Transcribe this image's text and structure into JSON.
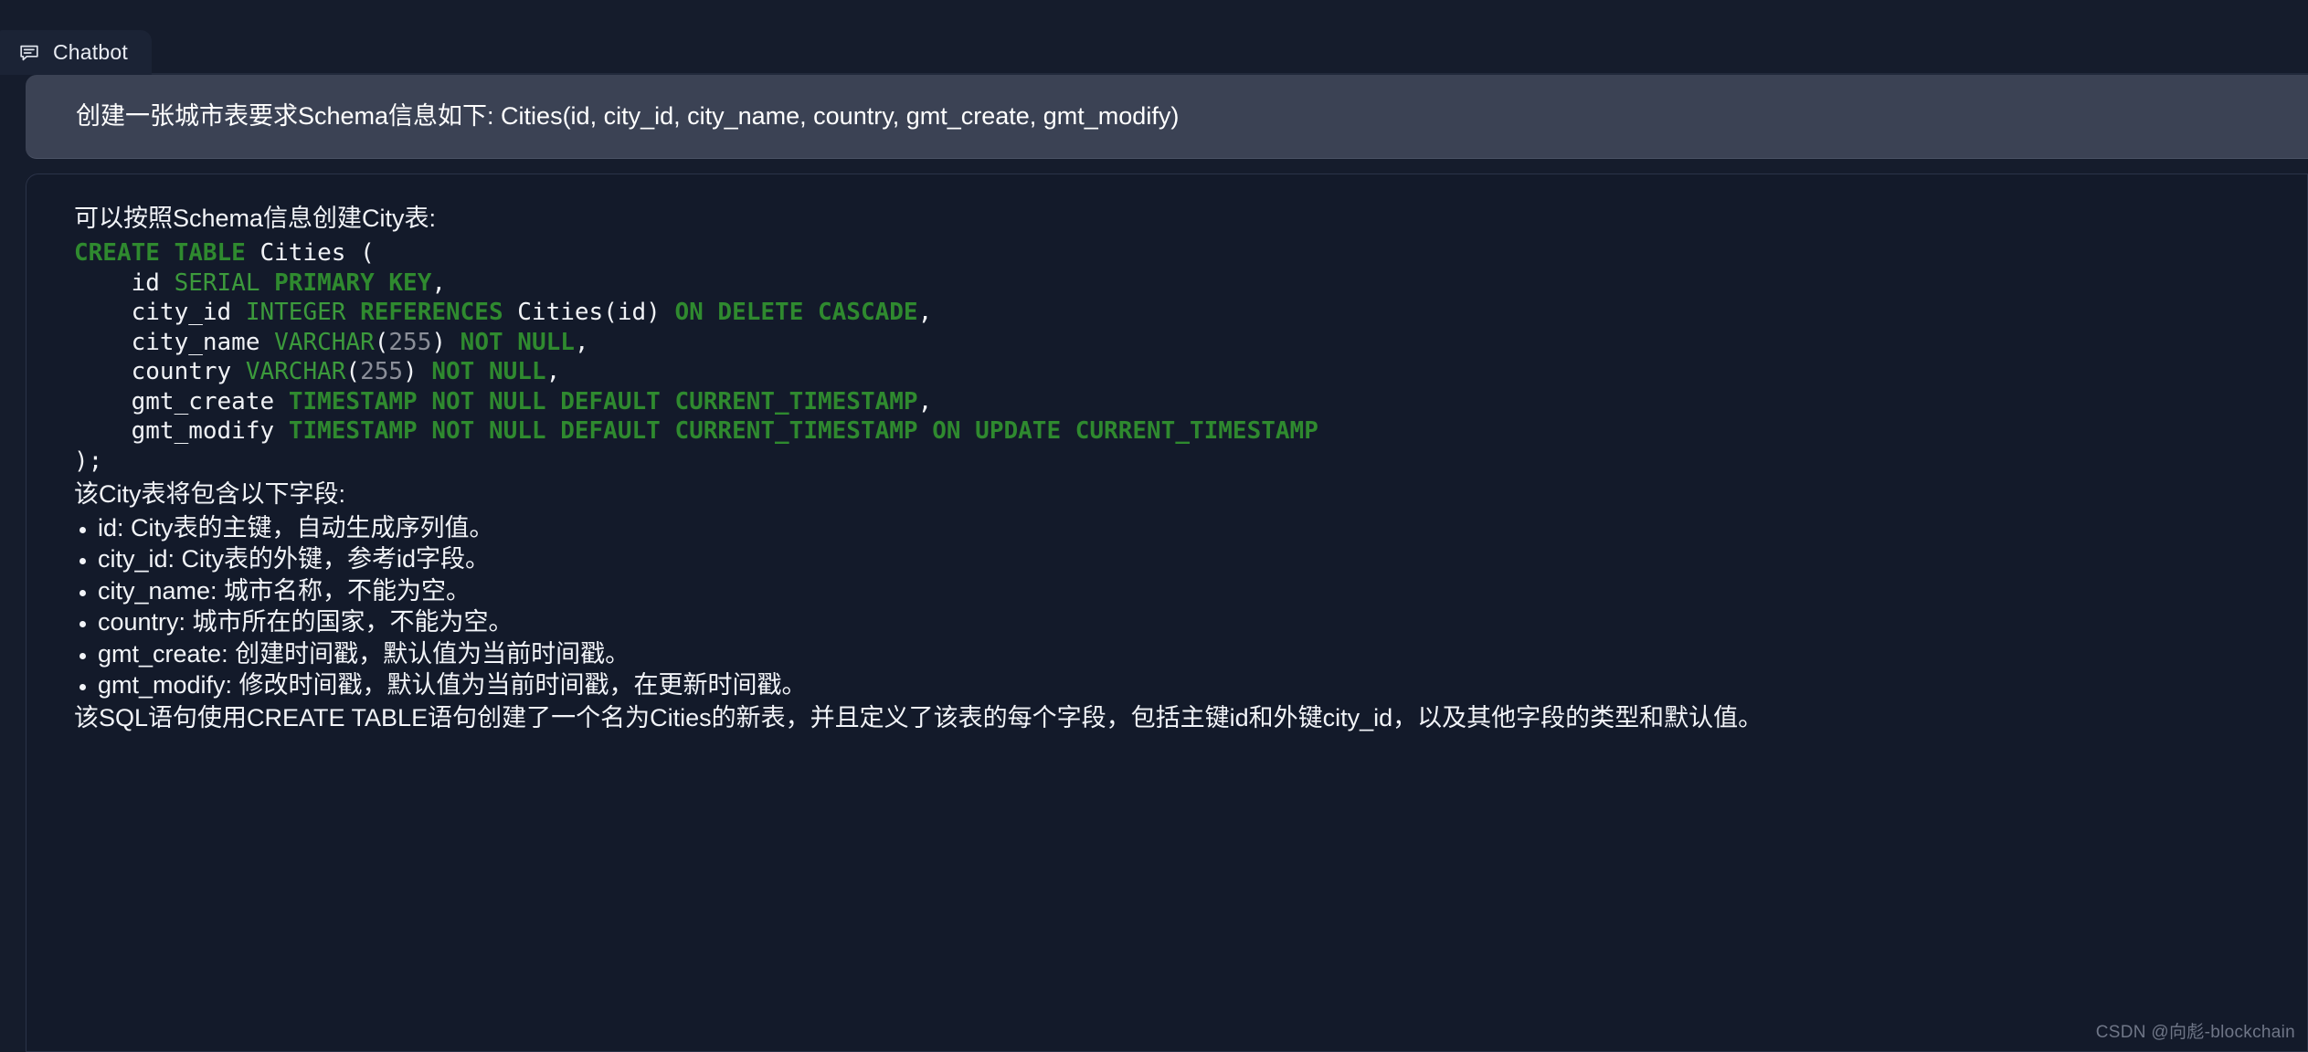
{
  "window": {
    "background_color": "#151c2c"
  },
  "tabs": [
    {
      "label": "Chatbot",
      "icon": "chat-bubble-icon",
      "active": true
    }
  ],
  "conversation": {
    "user_message": {
      "role": "user",
      "text": "创建一张城市表要求Schema信息如下: Cities(id, city_id, city_name, country, gmt_create, gmt_modify)",
      "background_color": "#3b4254"
    },
    "bot_message": {
      "role": "assistant",
      "lead_text": "可以按照Schema信息创建City表:",
      "code_block": {
        "language": "sql",
        "keyword_color": "#2f8a2f",
        "type_color": "#3c9a3c",
        "number_color": "#8b8f99",
        "plain_color": "#f0f2f6",
        "lines": [
          [
            {
              "t": "CREATE TABLE",
              "c": "kw"
            },
            {
              "t": " Cities (",
              "c": "pln"
            }
          ],
          [
            {
              "t": "    id ",
              "c": "pln"
            },
            {
              "t": "SERIAL",
              "c": "typ"
            },
            {
              "t": " ",
              "c": "pln"
            },
            {
              "t": "PRIMARY KEY",
              "c": "kw"
            },
            {
              "t": ",",
              "c": "pln"
            }
          ],
          [
            {
              "t": "    city_id ",
              "c": "pln"
            },
            {
              "t": "INTEGER",
              "c": "typ"
            },
            {
              "t": " ",
              "c": "pln"
            },
            {
              "t": "REFERENCES",
              "c": "kw"
            },
            {
              "t": " Cities(id) ",
              "c": "pln"
            },
            {
              "t": "ON DELETE CASCADE",
              "c": "kw"
            },
            {
              "t": ",",
              "c": "pln"
            }
          ],
          [
            {
              "t": "    city_name ",
              "c": "pln"
            },
            {
              "t": "VARCHAR",
              "c": "typ"
            },
            {
              "t": "(",
              "c": "pln"
            },
            {
              "t": "255",
              "c": "num"
            },
            {
              "t": ") ",
              "c": "pln"
            },
            {
              "t": "NOT NULL",
              "c": "kw"
            },
            {
              "t": ",",
              "c": "pln"
            }
          ],
          [
            {
              "t": "    country ",
              "c": "pln"
            },
            {
              "t": "VARCHAR",
              "c": "typ"
            },
            {
              "t": "(",
              "c": "pln"
            },
            {
              "t": "255",
              "c": "num"
            },
            {
              "t": ") ",
              "c": "pln"
            },
            {
              "t": "NOT NULL",
              "c": "kw"
            },
            {
              "t": ",",
              "c": "pln"
            }
          ],
          [
            {
              "t": "    gmt_create ",
              "c": "pln"
            },
            {
              "t": "TIMESTAMP NOT NULL DEFAULT CURRENT_TIMESTAMP",
              "c": "kw"
            },
            {
              "t": ",",
              "c": "pln"
            }
          ],
          [
            {
              "t": "    gmt_modify ",
              "c": "pln"
            },
            {
              "t": "TIMESTAMP NOT NULL DEFAULT CURRENT_TIMESTAMP ON UPDATE CURRENT_TIMESTAMP",
              "c": "kw"
            }
          ],
          [
            {
              "t": ");",
              "c": "pln"
            }
          ]
        ]
      },
      "fields_intro": "该City表将包含以下字段:",
      "fields": [
        "id: City表的主键，自动生成序列值。",
        "city_id: City表的外键，参考id字段。",
        "city_name: 城市名称，不能为空。",
        "country: 城市所在的国家，不能为空。",
        "gmt_create: 创建时间戳，默认值为当前时间戳。",
        "gmt_modify: 修改时间戳，默认值为当前时间戳，在更新时间戳。"
      ],
      "summary": "该SQL语句使用CREATE TABLE语句创建了一个名为Cities的新表，并且定义了该表的每个字段，包括主键id和外键city_id，以及其他字段的类型和默认值。"
    }
  },
  "watermark": {
    "text": "CSDN @向彪-blockchain"
  }
}
